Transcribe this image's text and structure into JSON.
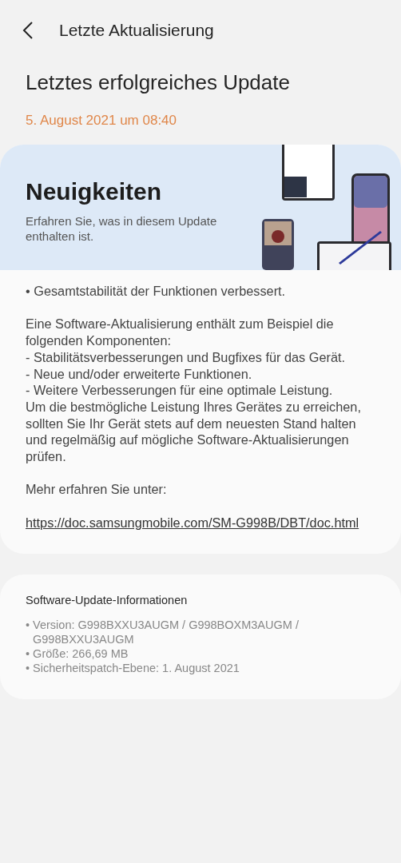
{
  "header": {
    "title": "Letzte Aktualisierung"
  },
  "heading": "Letztes erfolgreiches Update",
  "date": "5. August 2021 um 08:40",
  "news": {
    "title": "Neuigkeiten",
    "subtitle": "Erfahren Sie, was in diesem Update enthalten ist."
  },
  "notes": [
    {
      "lines": [
        "• Gesamtstabilität der Funktionen verbessert."
      ]
    },
    {
      "lines": [
        "Eine Software-Aktualisierung enthält zum Beispiel die folgenden Komponenten:",
        " - Stabilitätsverbesserungen und Bugfixes für das Gerät.",
        " - Neue und/oder erweiterte Funktionen.",
        " - Weitere Verbesserungen für eine optimale Leistung.",
        "Um die bestmögliche Leistung Ihres Gerätes zu erreichen, sollten Sie Ihr Gerät stets auf dem neuesten Stand halten und regelmäßig auf mögliche Software-Aktualisierungen prüfen."
      ]
    },
    {
      "lines": [
        "Mehr erfahren Sie unter:"
      ]
    }
  ],
  "link": "https://doc.samsungmobile.com/SM-G998B/DBT/doc.html",
  "info": {
    "title": "Software-Update-Informationen",
    "items": [
      "• Version: G998BXXU3AUGM / G998BOXM3AUGM / G998BXXU3AUGM",
      "• Größe: 266,69 MB",
      "• Sicherheitspatch-Ebene: 1. August 2021"
    ]
  }
}
